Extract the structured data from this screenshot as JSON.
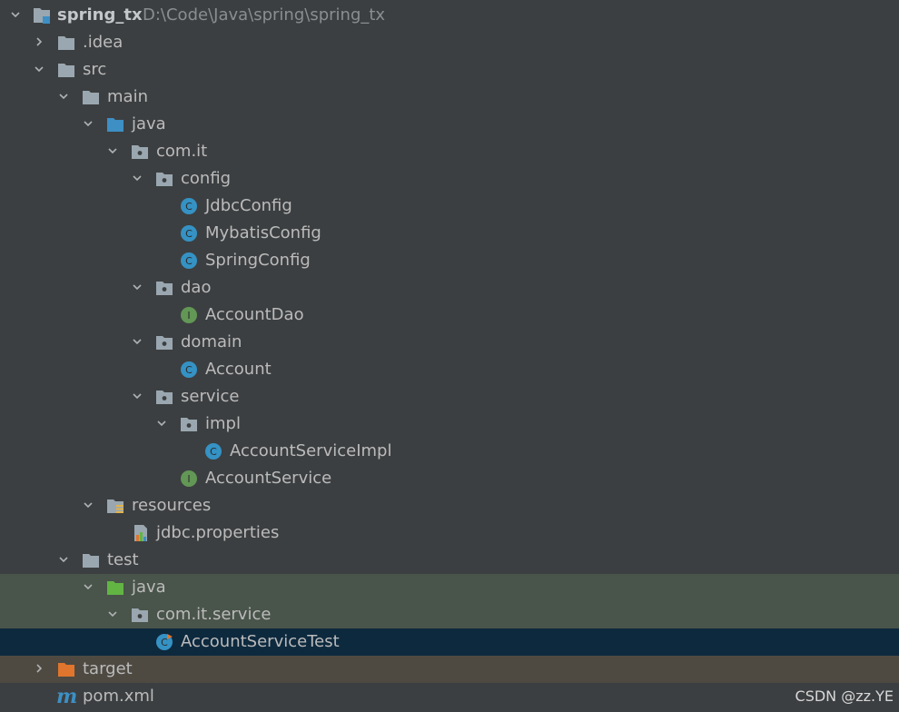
{
  "project": {
    "name": "spring_tx",
    "path": "D:\\Code\\Java\\spring\\spring_tx"
  },
  "items": {
    "idea": ".idea",
    "src": "src",
    "main": "main",
    "main_java": "java",
    "com_it": "com.it",
    "config": "config",
    "jdbc_config": "JdbcConfig",
    "mybatis_config": "MybatisConfig",
    "spring_config": "SpringConfig",
    "dao": "dao",
    "account_dao": "AccountDao",
    "domain": "domain",
    "account": "Account",
    "service": "service",
    "impl": "impl",
    "account_service_impl": "AccountServiceImpl",
    "account_service": "AccountService",
    "resources": "resources",
    "jdbc_properties": "jdbc.properties",
    "test": "test",
    "test_java": "java",
    "com_it_service": "com.it.service",
    "account_service_test": "AccountServiceTest",
    "target": "target",
    "pom": "pom.xml"
  },
  "class_badge": "C",
  "interface_badge": "I",
  "maven_badge": "m",
  "watermark": "CSDN @zz.YE",
  "colors": {
    "background": "#3c3f41",
    "test_row": "#49544a",
    "selected_row": "#0d293e",
    "excluded_row": "#4e4a42",
    "class_icon": "#3592c4",
    "interface_icon": "#629755",
    "folder": "#9aa7b0",
    "source_folder": "#3d8fc4",
    "test_folder": "#62b543",
    "excluded_folder": "#e0752d"
  }
}
